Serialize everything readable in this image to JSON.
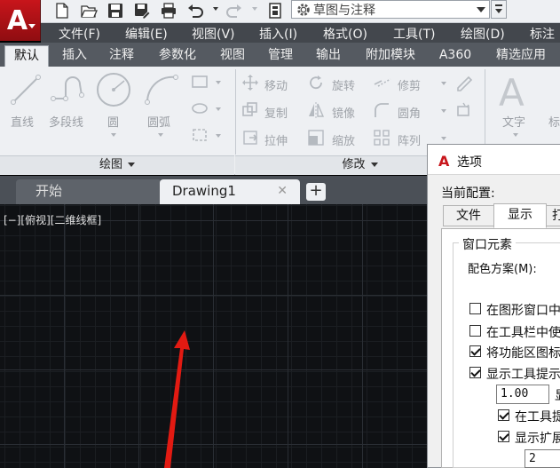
{
  "app": {
    "logo_letter": "A",
    "brand_color": "#c8151b"
  },
  "quick_access": {
    "workspace_value": "草图与注释",
    "icons": [
      "new-icon",
      "open-icon",
      "save-icon",
      "saveas-icon",
      "print-icon",
      "undo-icon",
      "redo-icon",
      "plot-icon",
      "gear-icon"
    ]
  },
  "menubar": {
    "items": [
      "文件(F)",
      "编辑(E)",
      "视图(V)",
      "插入(I)",
      "格式(O)",
      "工具(T)",
      "绘图(D)",
      "标注"
    ]
  },
  "ribbon_tabs": {
    "items": [
      "默认",
      "插入",
      "注释",
      "参数化",
      "视图",
      "管理",
      "输出",
      "附加模块",
      "A360",
      "精选应用"
    ],
    "active": "默认"
  },
  "ribbon": {
    "draw": {
      "title": "绘图",
      "tools": [
        "直线",
        "多段线",
        "圆",
        "圆弧"
      ]
    },
    "modify": {
      "title": "修改",
      "tools": [
        "移动",
        "旋转",
        "修剪",
        "复制",
        "镜像",
        "圆角",
        "拉伸",
        "缩放",
        "阵列"
      ]
    },
    "annotation": {
      "tools": [
        "文字",
        "标"
      ]
    }
  },
  "file_tabs": {
    "start": "开始",
    "drawing": "Drawing1",
    "close_glyph": "✕",
    "add_glyph": "+"
  },
  "viewport": {
    "label": "[−][俯视][二维线框]"
  },
  "options_dialog": {
    "title": "选项",
    "current_profile_label": "当前配置:",
    "tabs": [
      "文件",
      "显示",
      "打"
    ],
    "active_tab": "显示",
    "group_title": "窗口元素",
    "color_scheme_label": "配色方案(M):",
    "checkboxes": [
      {
        "label": "在图形窗口中",
        "checked": false
      },
      {
        "label": "在工具栏中使",
        "checked": false
      },
      {
        "label": "将功能区图标",
        "checked": true
      },
      {
        "label": "显示工具提示",
        "checked": true
      }
    ],
    "tooltip_delay_value": "1.00",
    "tooltip_delay_suffix": "显",
    "sub_checkboxes": [
      {
        "label": "在工具提",
        "checked": true
      },
      {
        "label": "显示扩展",
        "checked": true
      }
    ],
    "extended_delay_value": "2"
  }
}
